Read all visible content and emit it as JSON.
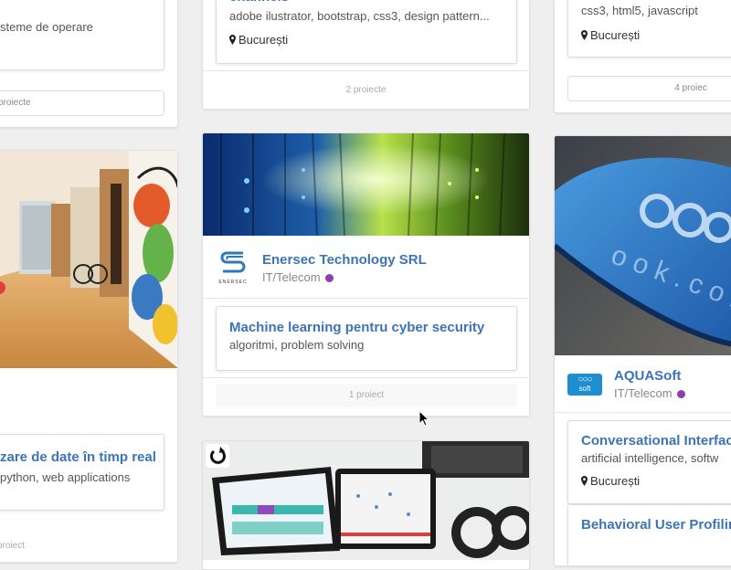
{
  "left": {
    "top_text": "steme de operare",
    "top_count": "proiecte",
    "project_title": "zare de date în timp real",
    "project_tags": "python, web applications",
    "bottom_count": "proiect"
  },
  "middle": {
    "top_project": {
      "title": "channels",
      "tags": "adobe ilustrator, bootstrap, css3, design pattern...",
      "location": "București",
      "count": "2 proiecte"
    },
    "company": {
      "name": "Enersec Technology SRL",
      "industry": "IT/Telecom",
      "logo_text": "ENERSEC"
    },
    "project": {
      "title": "Machine learning pentru cyber security",
      "tags": "algoritmi, problem solving",
      "count": "1 proiect"
    }
  },
  "right": {
    "top_project": {
      "tags": "css3, html5, javascript",
      "location": "București",
      "count": "4 proiec"
    },
    "company": {
      "name": "AQUASoft",
      "industry": "IT/Telecom",
      "logo_text": "soft"
    },
    "projects": [
      {
        "title": "Conversational Interface",
        "tags": "artificial intelligence, softw",
        "location": "București"
      },
      {
        "title": "Behavioral User Profiling"
      }
    ]
  },
  "colors": {
    "link": "#3c74b8",
    "category_dot": "#8b3fb0",
    "background": "#efefef"
  },
  "icons": [
    "map-marker-icon",
    "enersec-logo",
    "aquasoft-logo",
    "company-banner-image",
    "cursor-pointer"
  ]
}
